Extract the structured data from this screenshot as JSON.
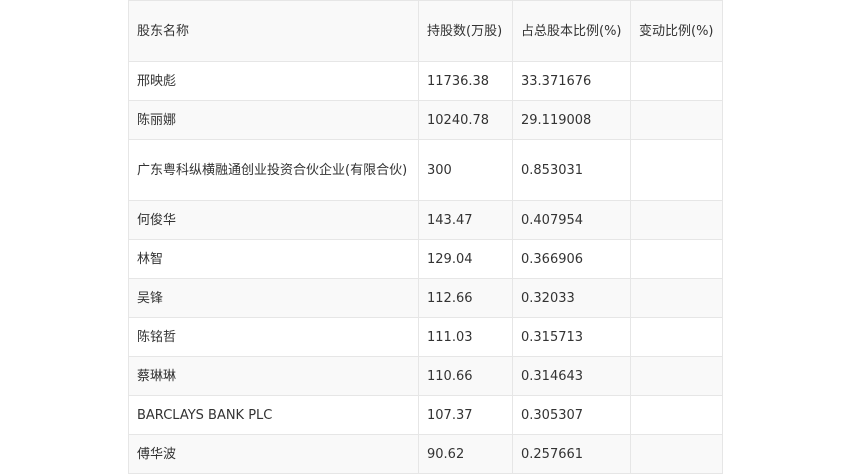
{
  "table": {
    "headers": [
      "股东名称",
      "持股数(万股)",
      "占总股本比例(%)",
      "变动比例(%)"
    ],
    "rows": [
      [
        "邢映彪",
        "11736.38",
        "33.371676",
        ""
      ],
      [
        "陈丽娜",
        "10240.78",
        "29.119008",
        ""
      ],
      [
        "广东粤科纵横融通创业投资合伙企业(有限合伙)",
        "300",
        "0.853031",
        ""
      ],
      [
        "何俊华",
        "143.47",
        "0.407954",
        ""
      ],
      [
        "林智",
        "129.04",
        "0.366906",
        ""
      ],
      [
        "吴锋",
        "112.66",
        "0.32033",
        ""
      ],
      [
        "陈铭哲",
        "111.03",
        "0.315713",
        ""
      ],
      [
        "蔡琳琳",
        "110.66",
        "0.314643",
        ""
      ],
      [
        "BARCLAYS BANK PLC",
        "107.37",
        "0.305307",
        ""
      ],
      [
        "傅华波",
        "90.62",
        "0.257661",
        ""
      ]
    ]
  }
}
